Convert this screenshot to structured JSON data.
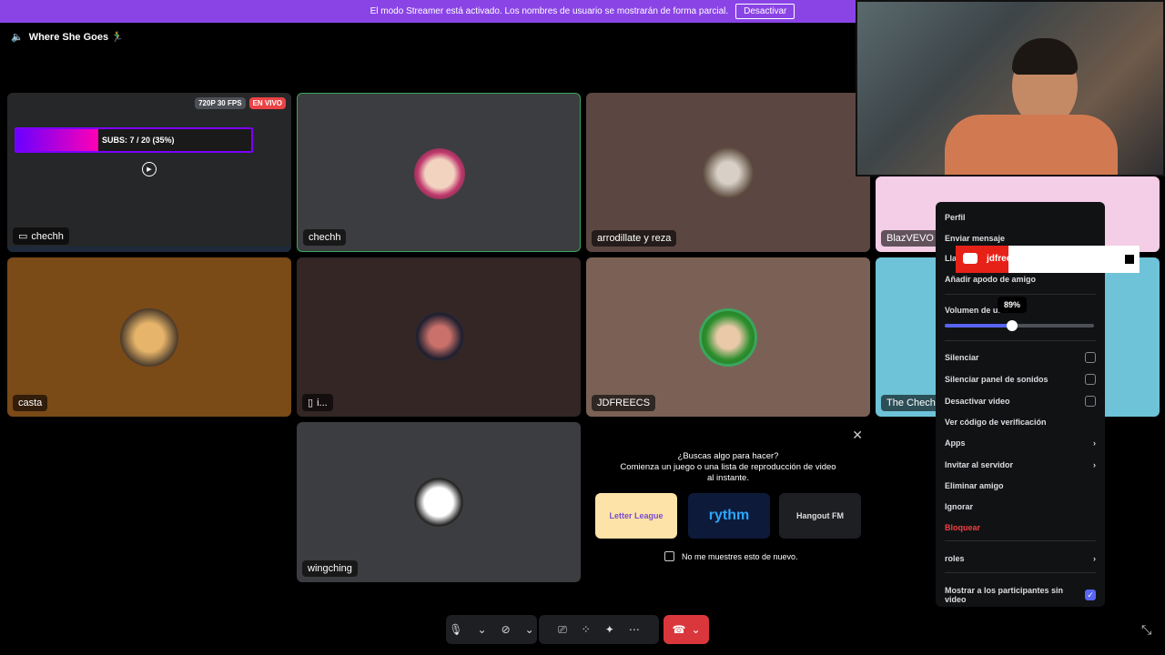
{
  "banner": {
    "text": "El modo Streamer está activado. Los nombres de usuario se mostrarán de forma parcial.",
    "button": "Desactivar"
  },
  "channel": {
    "name": "Where She Goes 🏃‍♂️",
    "icon": "speaker-icon"
  },
  "tiles": {
    "t1": {
      "label": "chechh",
      "res": "720P 30 FPS",
      "live": "EN VIVO",
      "subs": "SUBS: 7 / 20 (35%)",
      "subs_progress": 0.35
    },
    "t2": {
      "label": "chechh"
    },
    "t3": {
      "label": "arrodillate y reza"
    },
    "t4": {
      "label": "BlazVEVO"
    },
    "t5": {
      "label": "casta"
    },
    "t6": {
      "label": "i..."
    },
    "t7": {
      "label": "JDFREECS"
    },
    "t8": {
      "label": "The Chechh"
    },
    "t9": {
      "label": "wingching"
    }
  },
  "activity": {
    "title": "¿Buscas algo para hacer?",
    "subtitle": "Comienza un juego o una lista de reproducción de video al instante.",
    "cards": [
      "Letter League",
      "rythm",
      "Hangout FM"
    ],
    "checkbox_label": "No me muestres esto de nuevo."
  },
  "menu": {
    "perfil": "Perfil",
    "mensaje": "Enviar mensaje",
    "llamar": "Lla",
    "apodo": "Añadir apodo de amigo",
    "volumen": "Volumen de us",
    "volume_value": "89%",
    "silenciar": "Silenciar",
    "silenciar_panel": "Silenciar panel de sonidos",
    "desactivar_video": "Desactivar video",
    "ver_codigo": "Ver código de verificación",
    "apps": "Apps",
    "invitar": "Invitar al servidor",
    "eliminar": "Eliminar amigo",
    "ignorar": "Ignorar",
    "bloquear": "Bloquear",
    "roles": "roles",
    "mostrar": "Mostrar a los participantes sin video"
  },
  "youtube_overlay": {
    "name": "jdfreecs"
  },
  "colors": {
    "banner": "#8a44e6",
    "accent": "#5865f2",
    "danger": "#f23f42",
    "end_call": "#da373c"
  }
}
